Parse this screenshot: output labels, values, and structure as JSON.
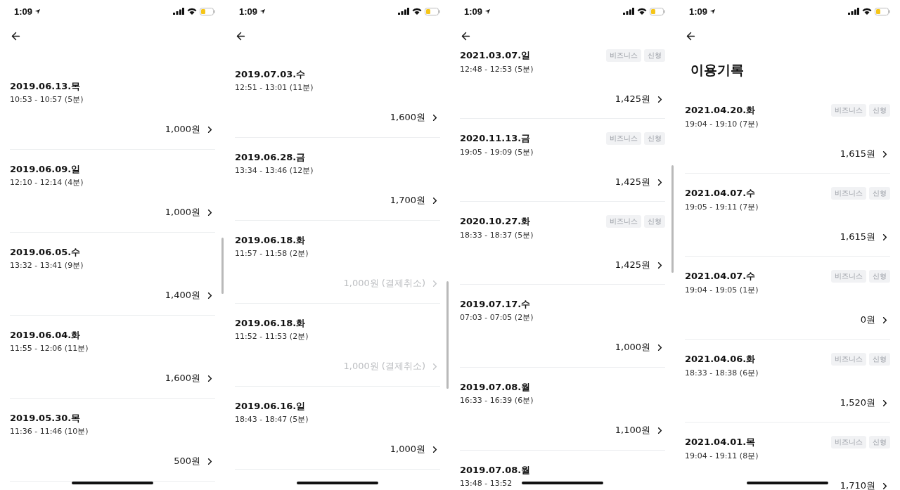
{
  "screens": [
    {
      "status_bar": {
        "time": "1:09"
      },
      "records": [
        {
          "date": "2019.06.13.목",
          "time": "10:53 - 10:57 (5분)",
          "amount": "1,000원",
          "cancelled": false
        },
        {
          "date": "2019.06.09.일",
          "time": "12:10 - 12:14 (4분)",
          "amount": "1,000원",
          "cancelled": false
        },
        {
          "date": "2019.06.05.수",
          "time": "13:32 - 13:41 (9분)",
          "amount": "1,400원",
          "cancelled": false
        },
        {
          "date": "2019.06.04.화",
          "time": "11:55 - 12:06 (11분)",
          "amount": "1,600원",
          "cancelled": false
        },
        {
          "date": "2019.05.30.목",
          "time": "11:36 - 11:46 (10분)",
          "amount": "500원",
          "cancelled": false
        }
      ]
    },
    {
      "status_bar": {
        "time": "1:09"
      },
      "records": [
        {
          "date": "2019.07.03.수",
          "time": "12:51 - 13:01 (11분)",
          "amount": "1,600원",
          "cancelled": false
        },
        {
          "date": "2019.06.28.금",
          "time": "13:34 - 13:46 (12분)",
          "amount": "1,700원",
          "cancelled": false
        },
        {
          "date": "2019.06.18.화",
          "time": "11:57 - 11:58 (2분)",
          "amount": "1,000원 (결제취소)",
          "cancelled": true
        },
        {
          "date": "2019.06.18.화",
          "time": "11:52 - 11:53 (2분)",
          "amount": "1,000원 (결제취소)",
          "cancelled": true
        },
        {
          "date": "2019.06.16.일",
          "time": "18:43 - 18:47 (5분)",
          "amount": "1,000원",
          "cancelled": false
        }
      ]
    },
    {
      "status_bar": {
        "time": "1:09"
      },
      "records": [
        {
          "date": "2021.03.07.일",
          "time": "12:48 - 12:53 (5분)",
          "tags": [
            "비즈니스",
            "신형"
          ],
          "amount": "1,425원",
          "cancelled": false
        },
        {
          "date": "2020.11.13.금",
          "time": "19:05 - 19:09 (5분)",
          "tags": [
            "비즈니스",
            "신형"
          ],
          "amount": "1,425원",
          "cancelled": false
        },
        {
          "date": "2020.10.27.화",
          "time": "18:33 - 18:37 (5분)",
          "tags": [
            "비즈니스",
            "신형"
          ],
          "amount": "1,425원",
          "cancelled": false
        },
        {
          "date": "2019.07.17.수",
          "time": "07:03 - 07:05 (2분)",
          "amount": "1,000원",
          "cancelled": false
        },
        {
          "date": "2019.07.08.월",
          "time": "16:33 - 16:39 (6분)",
          "amount": "1,100원",
          "cancelled": false
        },
        {
          "date": "2019.07.08.월",
          "time": "13:48 - 13:52"
        }
      ]
    },
    {
      "status_bar": {
        "time": "1:09"
      },
      "title": "이용기록",
      "records": [
        {
          "date": "2021.04.20.화",
          "time": "19:04 - 19:10 (7분)",
          "tags": [
            "비즈니스",
            "신형"
          ],
          "amount": "1,615원",
          "cancelled": false
        },
        {
          "date": "2021.04.07.수",
          "time": "19:05 - 19:11 (7분)",
          "tags": [
            "비즈니스",
            "신형"
          ],
          "amount": "1,615원",
          "cancelled": false
        },
        {
          "date": "2021.04.07.수",
          "time": "19:04 - 19:05 (1분)",
          "tags": [
            "비즈니스",
            "신형"
          ],
          "amount": "0원",
          "cancelled": false
        },
        {
          "date": "2021.04.06.화",
          "time": "18:33 - 18:38 (6분)",
          "tags": [
            "비즈니스",
            "신형"
          ],
          "amount": "1,520원",
          "cancelled": false
        },
        {
          "date": "2021.04.01.목",
          "time": "19:04 - 19:11 (8분)",
          "tags": [
            "비즈니스",
            "신형"
          ],
          "amount": "1,710원",
          "cancelled": false
        }
      ]
    }
  ]
}
